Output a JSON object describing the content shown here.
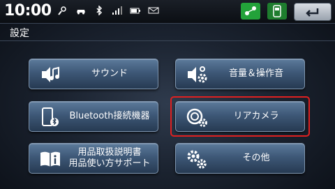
{
  "status": {
    "time": "10:00",
    "icons": [
      "satellite-signal-icon",
      "car-icon",
      "bluetooth-icon",
      "cell-signal-icon",
      "battery-icon",
      "message-icon"
    ],
    "indicators": [
      "eco-indicator-icon",
      "car-mode-indicator-icon"
    ],
    "back_icon": "back-arrow-icon"
  },
  "page": {
    "title": "設定"
  },
  "menu": {
    "items": [
      {
        "label": "サウンド",
        "icon": "speaker-music-icon"
      },
      {
        "label": "音量＆操作音",
        "icon": "speaker-gear-icon"
      },
      {
        "label": "Bluetooth接続機器",
        "icon": "phone-bluetooth-icon"
      },
      {
        "label": "リアカメラ",
        "icon": "camera-gear-icon",
        "selected": true
      },
      {
        "label_line1": "用品取扱説明書",
        "label_line2": "用品使い方サポート",
        "icon": "manual-book-icon"
      },
      {
        "label": "その他",
        "icon": "gears-icon"
      }
    ]
  },
  "colors": {
    "selection": "#e02020",
    "indicator": "#23a23a",
    "button": "#3e5877"
  }
}
